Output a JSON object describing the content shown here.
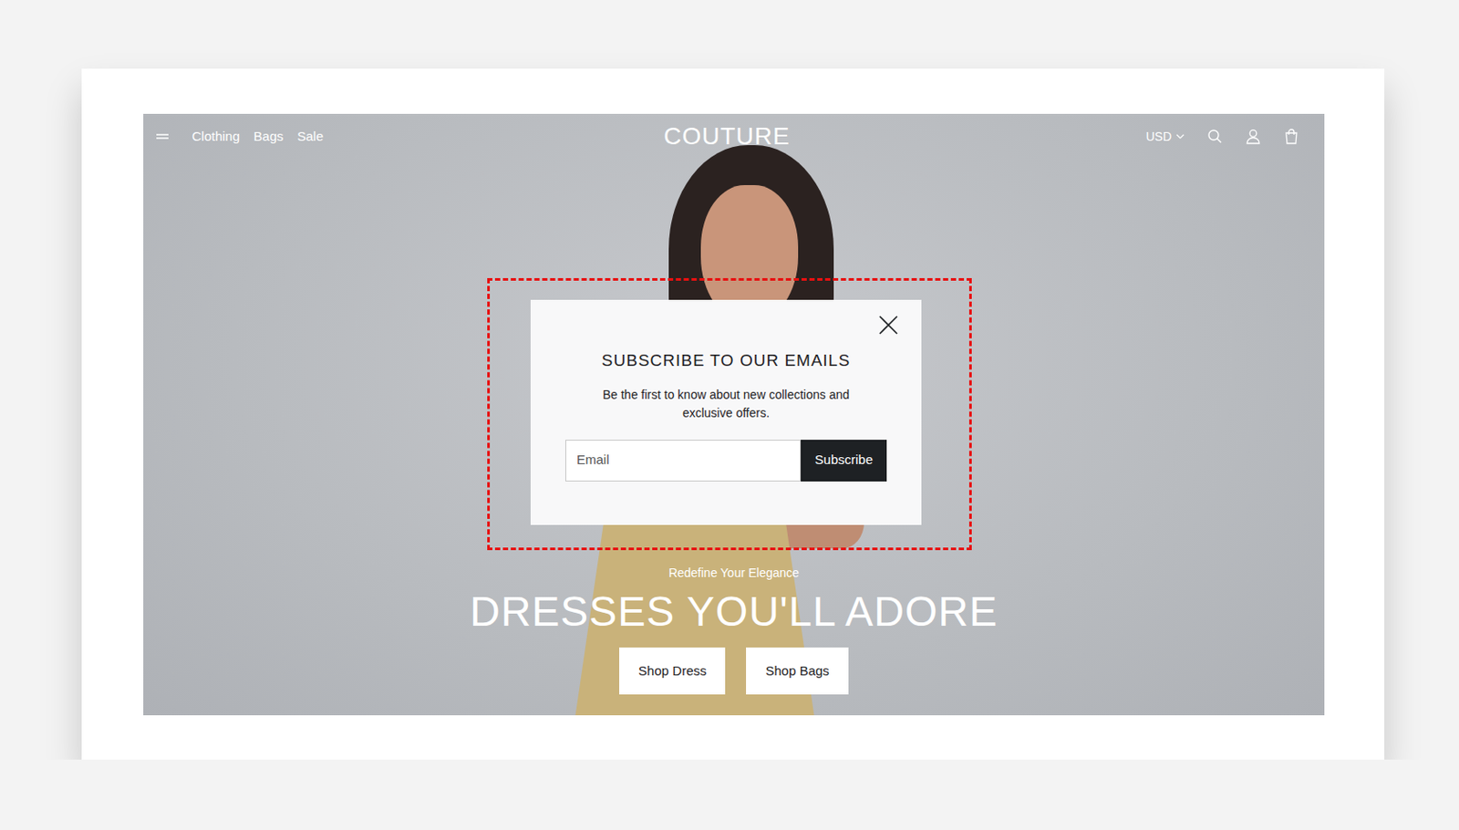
{
  "header": {
    "nav": [
      "Clothing",
      "Bags",
      "Sale"
    ],
    "logo": "COUTURE",
    "currency": "USD"
  },
  "hero": {
    "eyebrow": "Redefine Your Elegance",
    "title": "DRESSES YOU'LL ADORE",
    "buttons": [
      "Shop Dress",
      "Shop Bags"
    ]
  },
  "popup": {
    "highlighted": true,
    "title": "SUBSCRIBE TO OUR EMAILS",
    "text": "Be the first to know about new collections and exclusive offers.",
    "email_placeholder": "Email",
    "button": "Subscribe"
  }
}
